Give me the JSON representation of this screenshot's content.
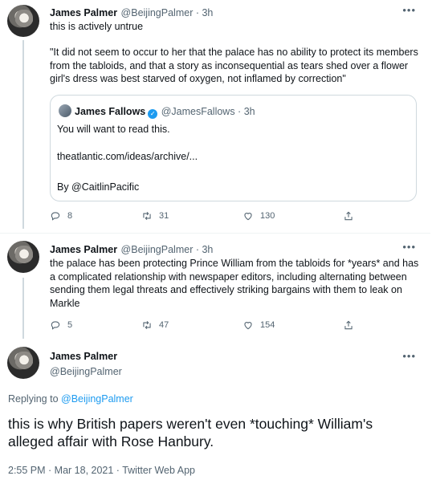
{
  "tweets": [
    {
      "name": "James Palmer",
      "handle": "@BeijingPalmer · 3h",
      "line1": "this is actively untrue",
      "line2": "\"It did not seem to occur to her that the palace has no ability to protect its members from the tabloids, and that a story as inconsequential as tears shed over a flower girl's dress was best starved of oxygen, not inflamed by correction\"",
      "quote": {
        "name": "James Fallows",
        "handle": "@JamesFallows · 3h",
        "text1": "You will want to read this.",
        "text2": "theatlantic.com/ideas/archive/...",
        "text3": "By @CaitlinPacific"
      },
      "stats": {
        "replies": "8",
        "retweets": "31",
        "likes": "130"
      }
    },
    {
      "name": "James Palmer",
      "handle": "@BeijingPalmer · 3h",
      "text": "the palace has been protecting Prince William from the tabloids for *years* and has a complicated relationship with newspaper editors, including alternating between sending them legal threats and effectively striking bargains with them to leak on Markle",
      "stats": {
        "replies": "5",
        "retweets": "47",
        "likes": "154"
      }
    }
  ],
  "focused": {
    "name": "James Palmer",
    "handle": "@BeijingPalmer",
    "replying_prefix": "Replying to",
    "replying_to": "@BeijingPalmer",
    "text": "this is why British papers weren't even *touching* William's alleged affair with Rose Hanbury.",
    "meta": "2:55 PM · Mar 18, 2021 · Twitter Web App"
  },
  "colors": {
    "accent": "#1d9bf0",
    "secondary": "#536471",
    "border": "#cfd9de"
  },
  "icons": [
    "more-icon",
    "reply-icon",
    "retweet-icon",
    "like-icon",
    "share-icon",
    "verified-icon"
  ]
}
